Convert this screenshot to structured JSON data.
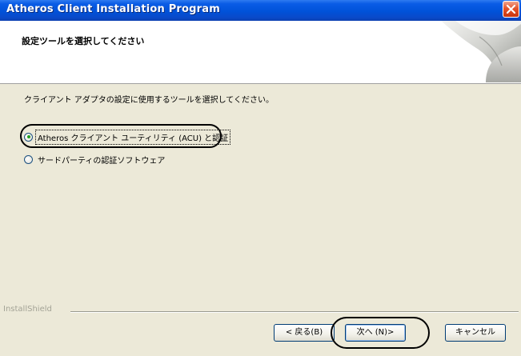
{
  "window": {
    "title": "Atheros Client Installation Program"
  },
  "header": {
    "title": "設定ツールを選択してください"
  },
  "main": {
    "instruction": "クライアント アダプタの設定に使用するツールを選択してください。",
    "options": [
      {
        "label": "Atheros クライアント ユーティリティ (ACU) と認証",
        "selected": true
      },
      {
        "label": "サードパーティの認証ソフトウェア",
        "selected": false
      }
    ]
  },
  "footer": {
    "brand": "InstallShield",
    "back_label": "< 戻る(B)",
    "next_label": "次へ (N)>",
    "cancel_label": "キャンセル"
  },
  "colors": {
    "titlebar": "#0052d9",
    "dialog_bg": "#ece9d8",
    "close_button": "#e5532b",
    "radio_selected": "#21a121"
  },
  "icons": [
    "close-icon",
    "installshield-header-art"
  ]
}
